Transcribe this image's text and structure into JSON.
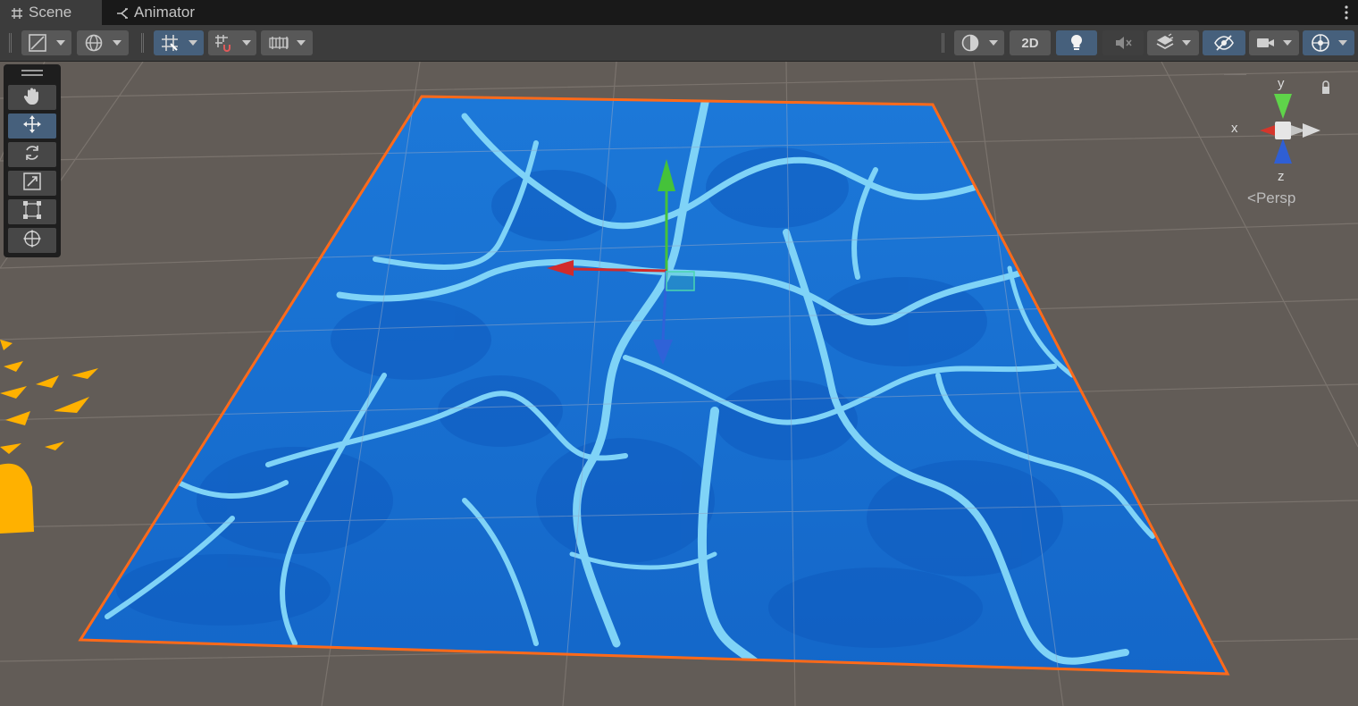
{
  "tabs": [
    {
      "label": "Scene",
      "icon": "grid-hash-icon",
      "active": true
    },
    {
      "label": "Animator",
      "icon": "animator-branch-icon",
      "active": false
    }
  ],
  "toolbar": {
    "left": [
      "draw-mode-dropdown",
      "global-local-dropdown",
      "grid-snap-dropdown",
      "snap-increment-dropdown",
      "ruler-dropdown"
    ],
    "right": [
      "shading-dropdown",
      "2d-toggle",
      "lighting-toggle",
      "audio-toggle",
      "effects-dropdown",
      "visibility-toggle",
      "camera-dropdown",
      "gizmos-dropdown"
    ],
    "toggle_2d_label": "2D"
  },
  "tools": [
    "hand-tool",
    "move-tool",
    "rotate-tool",
    "scale-tool",
    "rect-tool",
    "transform-tool"
  ],
  "active_tool": "move-tool",
  "gizmo": {
    "y_label": "y",
    "x_label": "x",
    "z_label": "z",
    "view_label": "Persp"
  },
  "colors": {
    "water": "#1a72d6",
    "water_light": "#7ed0f6",
    "selection_outline": "#ff6a1a",
    "axis_x": "#d12b2b",
    "axis_y": "#45c23a",
    "axis_z": "#2f62d8",
    "active_button": "#46607c"
  }
}
